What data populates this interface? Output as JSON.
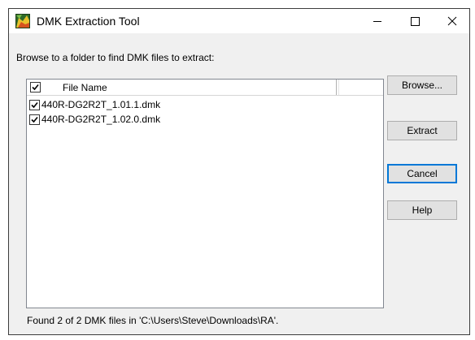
{
  "window": {
    "title": "DMK Extraction Tool",
    "icon": "dmk-app-icon"
  },
  "caption_buttons": {
    "minimize": "minimize-icon",
    "maximize": "maximize-icon",
    "close": "close-icon"
  },
  "prompt": "Browse to a folder to find DMK files to extract:",
  "list": {
    "header_checked": true,
    "columns": [
      "File Name"
    ],
    "rows": [
      {
        "checked": true,
        "name": "440R-DG2R2T_1.01.1.dmk"
      },
      {
        "checked": true,
        "name": "440R-DG2R2T_1.02.0.dmk"
      }
    ]
  },
  "buttons": {
    "browse": "Browse...",
    "extract": "Extract",
    "cancel": "Cancel",
    "help": "Help"
  },
  "status": "Found 2 of 2 DMK files in 'C:\\Users\\Steve\\Downloads\\RA'."
}
